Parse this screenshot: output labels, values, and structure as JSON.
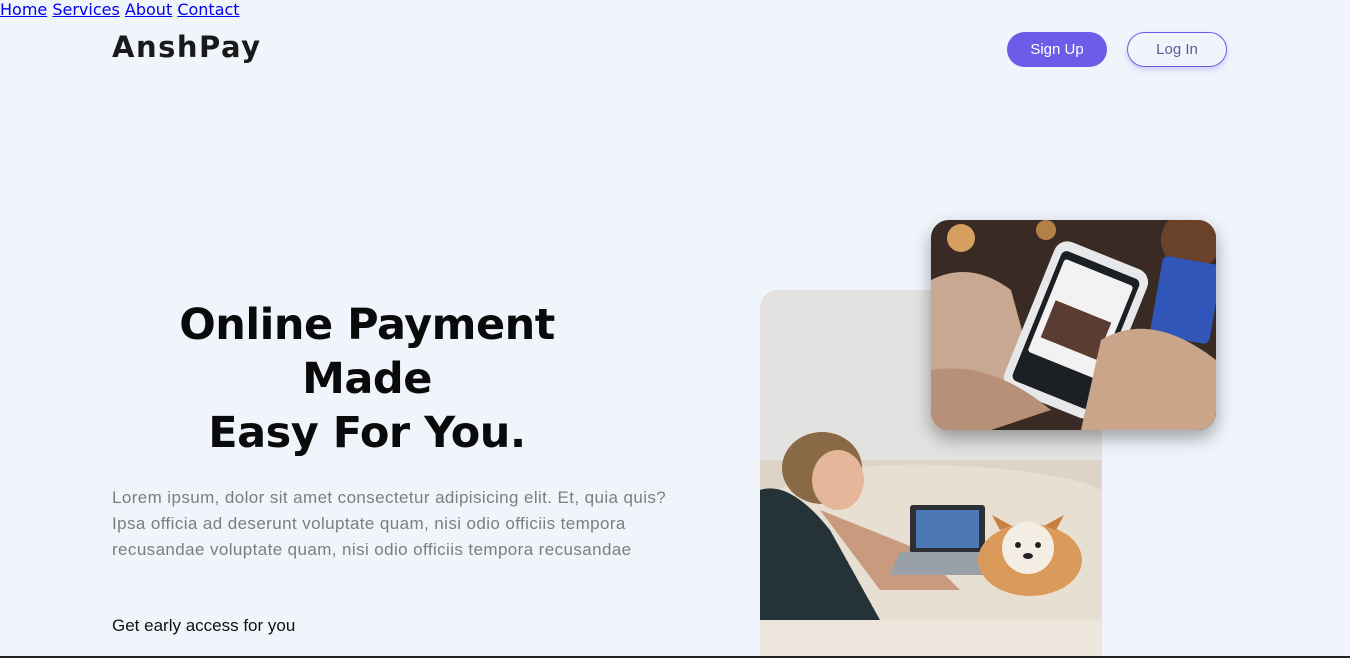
{
  "brand": {
    "name": "AnshPay",
    "accent": "#6c5ce7"
  },
  "nav": {
    "links": [
      "Home",
      "Services",
      "About",
      "Contact"
    ],
    "signup_label": "Sign Up",
    "login_label": "Log In"
  },
  "hero": {
    "title_line1": "Online Payment Made",
    "title_line2": "Easy For You.",
    "description": "Lorem ipsum, dolor sit amet consectetur adipisicing elit. Et, quia quis? Ipsa officia ad deserunt voluptate quam, nisi odio officiis tempora recusandae voluptate quam, nisi odio officiis tempora recusandae",
    "cta_text": "Get early access for you"
  },
  "images": {
    "back": "photo-woman-laptop-dog",
    "front": "photo-phone-shopping-card"
  }
}
